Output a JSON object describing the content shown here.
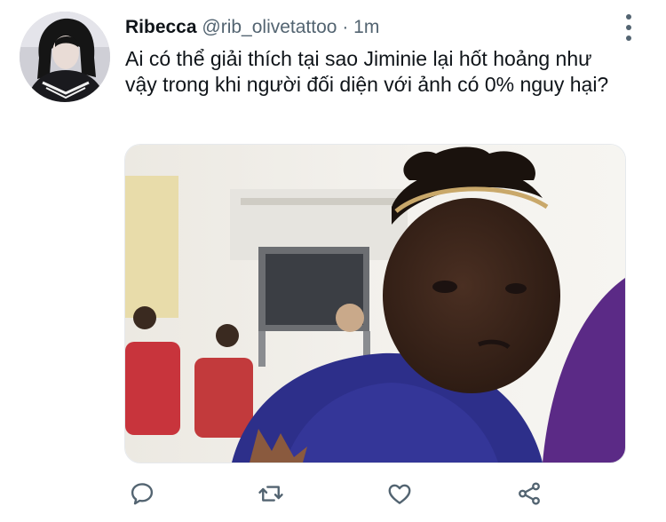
{
  "tweet": {
    "author_name": "Ribecca",
    "author_handle": "@rib_olivetattoo",
    "separator": "·",
    "timestamp": "1m",
    "text": "Ai có thể giải thích tại sao Jiminie lại hốt hoảng như vậy trong khi người đối diện với ảnh có 0% nguy hại?"
  },
  "actions": [
    {
      "icon": "reply-icon"
    },
    {
      "icon": "retweet-icon"
    },
    {
      "icon": "like-icon"
    },
    {
      "icon": "share-icon"
    }
  ],
  "colors": {
    "text_primary": "#0f1419",
    "text_secondary": "#536471",
    "icon": "#536471"
  }
}
